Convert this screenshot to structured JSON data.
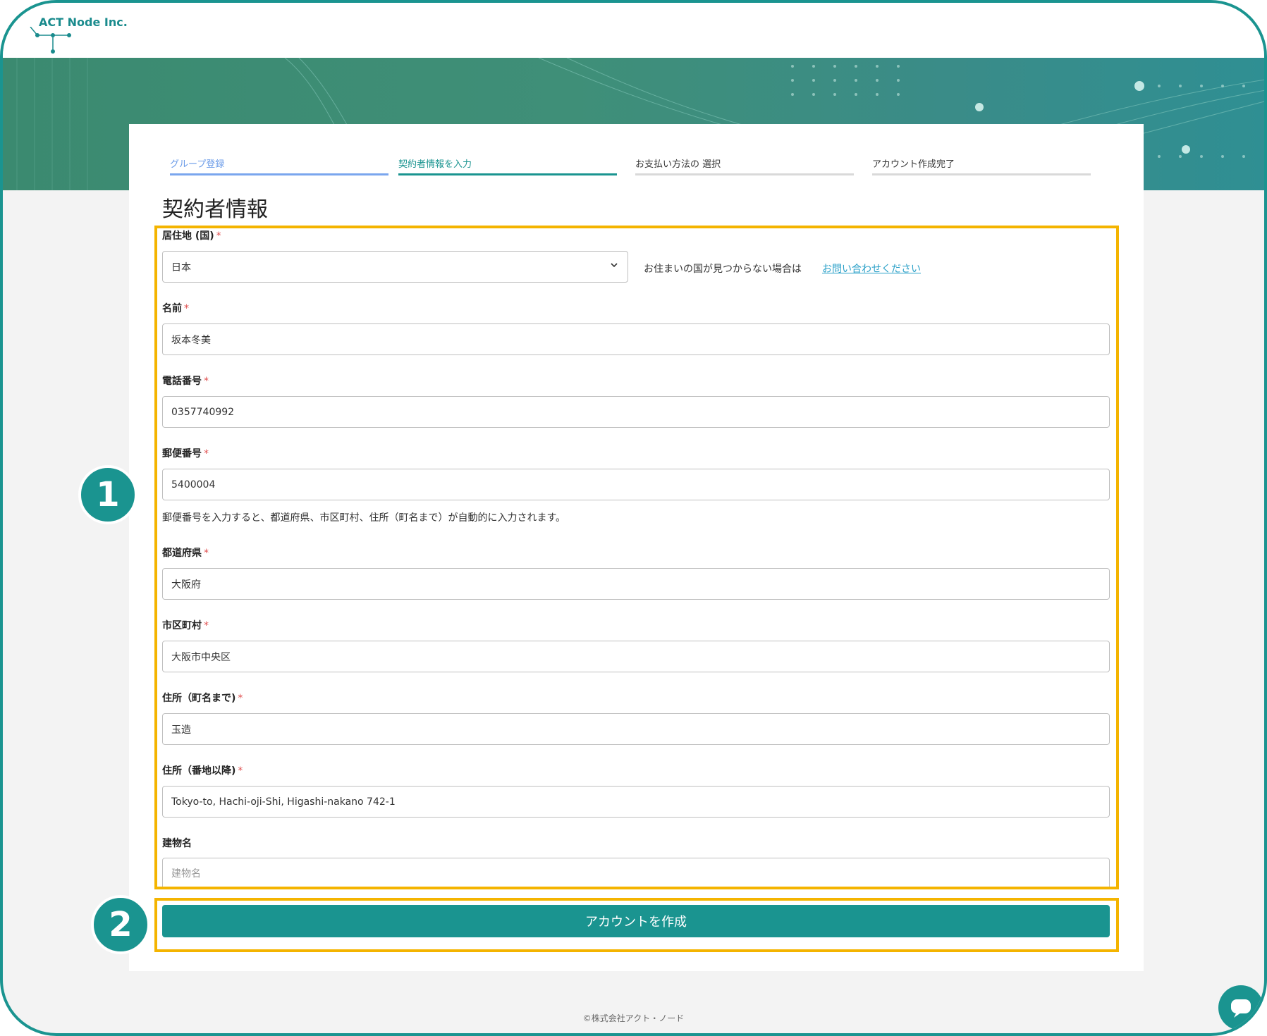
{
  "brand": {
    "name": "ACT Node Inc."
  },
  "steps": [
    {
      "label": "グループ登録",
      "state": "done"
    },
    {
      "label": "契約者情報を入力",
      "state": "active"
    },
    {
      "label": "お支払い方法の 選択",
      "state": "pending"
    },
    {
      "label": "アカウント作成完了",
      "state": "pending"
    }
  ],
  "page": {
    "title": "契約者情報"
  },
  "form": {
    "country": {
      "label": "居住地 (国)",
      "required": "*",
      "value": "日本",
      "note": "お住まいの国が見つからない場合は",
      "link": "お問い合わせください"
    },
    "name": {
      "label": "名前",
      "required": "*",
      "value": "坂本冬美"
    },
    "phone": {
      "label": "電話番号",
      "required": "*",
      "value": "0357740992"
    },
    "postal": {
      "label": "郵便番号",
      "required": "*",
      "value": "5400004",
      "hint": "郵便番号を入力すると、都道府県、市区町村、住所（町名まで）が自動的に入力されます。"
    },
    "prefecture": {
      "label": "都道府県",
      "required": "*",
      "value": "大阪府"
    },
    "city": {
      "label": "市区町村",
      "required": "*",
      "value": "大阪市中央区"
    },
    "address1": {
      "label": "住所（町名まで)",
      "required": "*",
      "value": "玉造"
    },
    "address2": {
      "label": "住所（番地以降)",
      "required": "*",
      "value": "Tokyo-to, Hachi-oji-Shi, Higashi-nakano 742-1"
    },
    "building": {
      "label": "建物名",
      "placeholder": "建物名"
    }
  },
  "submit": {
    "label": "アカウントを作成"
  },
  "badges": {
    "one": "1",
    "two": "2"
  },
  "footer": {
    "text": "©株式会社アクト・ノード"
  },
  "colors": {
    "accent": "#1a9490",
    "highlight": "#f4b400",
    "required": "#e05050",
    "link": "#2aa0c8"
  }
}
